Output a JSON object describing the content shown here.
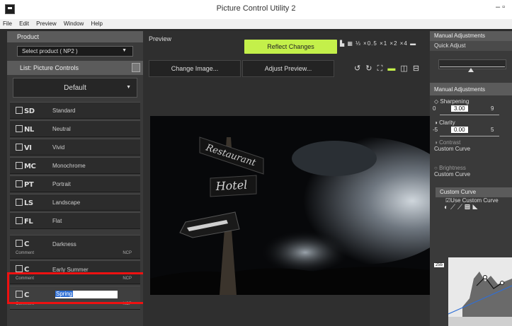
{
  "window": {
    "title": "Picture Control Utility 2",
    "controls": "–  ▫"
  },
  "menu": [
    "File",
    "Edit",
    "Preview",
    "Window",
    "Help"
  ],
  "left": {
    "product_header": "Product",
    "product_select": "Select product ( NP2 )",
    "list_header": "List: Picture Controls",
    "default_select": "Default",
    "items": [
      {
        "code": "SD",
        "name": "Standard"
      },
      {
        "code": "NL",
        "name": "Neutral"
      },
      {
        "code": "VI",
        "name": "Vivid"
      },
      {
        "code": "MC",
        "name": "Monochrome"
      },
      {
        "code": "PT",
        "name": "Portrait"
      },
      {
        "code": "LS",
        "name": "Landscape"
      },
      {
        "code": "FL",
        "name": "Flat"
      }
    ],
    "custom": [
      {
        "code": "C",
        "name": "Darkness",
        "comment": "Comment",
        "tag": "NCP"
      },
      {
        "code": "C",
        "name": "Early Summer",
        "comment": "Comment",
        "tag": "NCP"
      },
      {
        "code": "C",
        "name": "Spring",
        "comment": "Comment",
        "tag": "NCP"
      }
    ]
  },
  "center": {
    "preview_label": "Preview",
    "reflect_button": "Reflect Changes",
    "top_icons": "▙ ▦ ⅓ ×0.5 ×1 ×2 ×4 ▬",
    "change_image": "Change Image...",
    "adjust_preview": "Adjust Preview...",
    "view_icons": [
      "↺",
      "↻",
      "⛶",
      "▬",
      "◫",
      "⊟"
    ],
    "sign_restaurant": "Restaurant",
    "sign_hotel": "Hotel"
  },
  "right": {
    "manual_header": "Manual Adjustments",
    "quick_adjust": "Quick Adjust",
    "manual_sub": "Manual Adjustments",
    "sharpening": "Sharpening",
    "sharp_min": "0",
    "sharp_value": "3.00",
    "sharp_max": "9",
    "clarity": "Clarity",
    "clar_min": "-5",
    "clar_value": "0.00",
    "clar_max": "5",
    "contrast": "Contrast",
    "custom_curve_1": "Custom Curve",
    "brightness": "Brightness",
    "custom_curve_2": "Custom Curve",
    "curve_header": "Custom Curve",
    "use_custom_curve": "Use Custom Curve",
    "curve_value": "255"
  }
}
